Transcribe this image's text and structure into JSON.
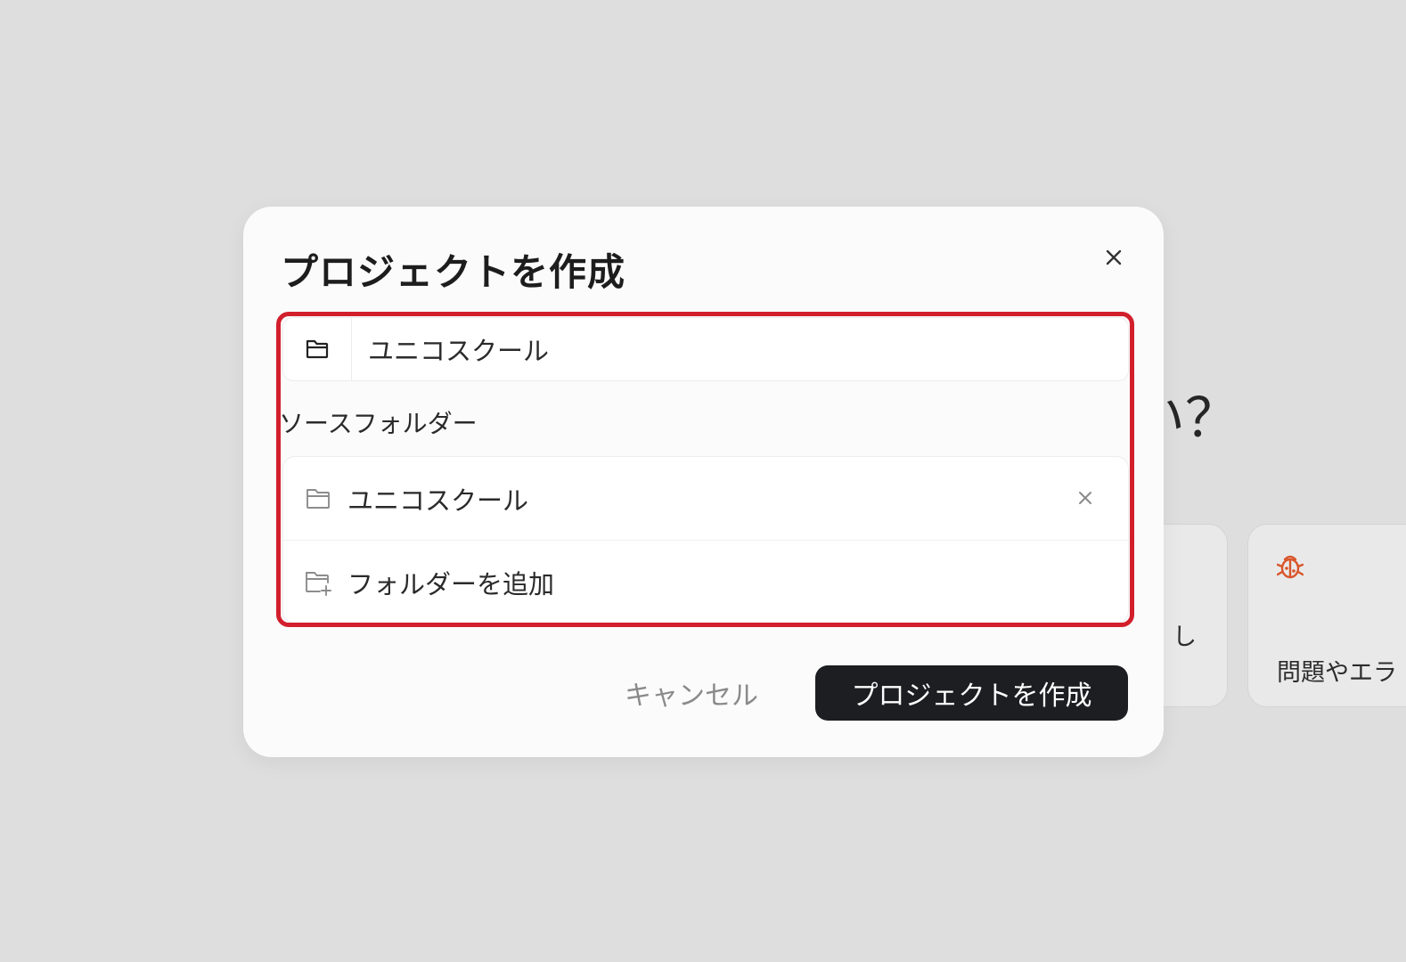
{
  "background": {
    "heading_fragment": "い？",
    "cards": [
      {
        "text_fragment": "し"
      },
      {
        "icon": "bug-icon",
        "text_fragment": "問題やエラ"
      }
    ]
  },
  "modal": {
    "title": "プロジェクトを作成",
    "close_icon": "close-icon",
    "project_name": {
      "value": "ユニコスクール",
      "icon": "folder-icon"
    },
    "source_folders": {
      "label": "ソースフォルダー",
      "items": [
        {
          "label": "ユニコスクール",
          "icon": "folder-icon",
          "remove_icon": "close-icon"
        }
      ],
      "add_label": "フォルダーを追加",
      "add_icon": "folder-add-icon"
    },
    "cancel_label": "キャンセル",
    "submit_label": "プロジェクトを作成"
  },
  "colors": {
    "backdrop": "#dedede",
    "modal_bg": "#fbfbfb",
    "highlight": "#d21f2c",
    "primary_button": "#1d1e22",
    "bug_icon": "#d9552b"
  }
}
